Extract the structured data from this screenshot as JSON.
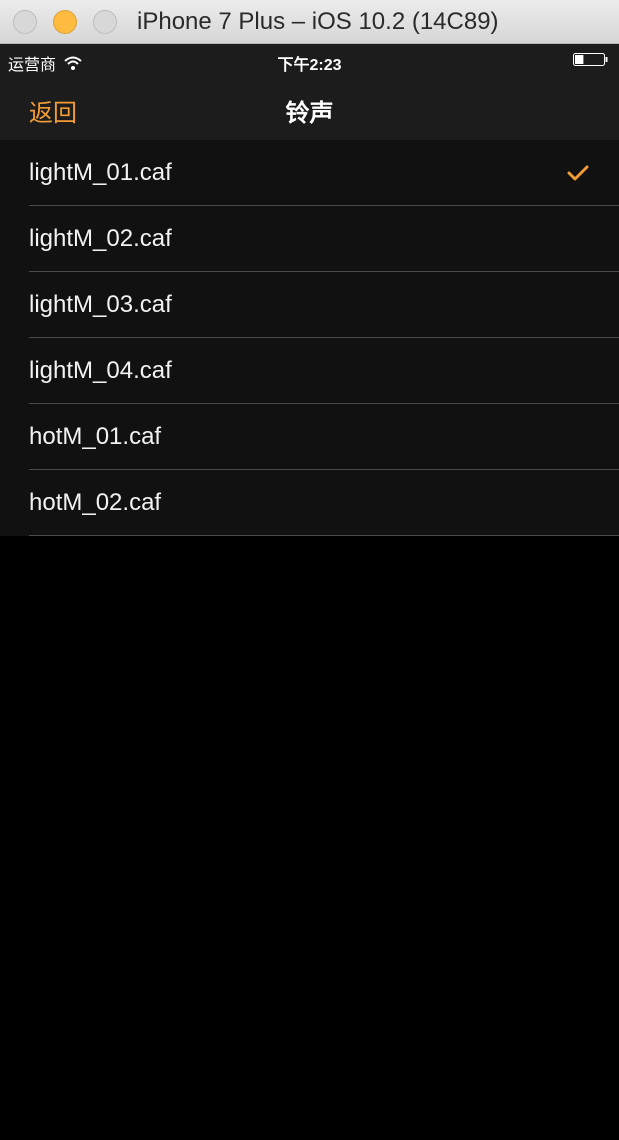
{
  "window": {
    "title": "iPhone 7 Plus – iOS 10.2 (14C89)"
  },
  "status_bar": {
    "carrier": "运营商",
    "time": "下午2:23",
    "battery_level": 0.3
  },
  "nav": {
    "back_label": "返回",
    "title": "铃声"
  },
  "ringtones": [
    {
      "label": "lightM_01.caf",
      "selected": true
    },
    {
      "label": "lightM_02.caf",
      "selected": false
    },
    {
      "label": "lightM_03.caf",
      "selected": false
    },
    {
      "label": "lightM_04.caf",
      "selected": false
    },
    {
      "label": "hotM_01.caf",
      "selected": false
    },
    {
      "label": "hotM_02.caf",
      "selected": false
    }
  ],
  "colors": {
    "accent": "#f39c35",
    "background": "#000000",
    "bar": "#1c1c1c",
    "cell": "#111111"
  },
  "icons": {
    "selected_mark": "checkmark-icon",
    "wifi": "wifi-icon",
    "battery": "battery-icon"
  }
}
